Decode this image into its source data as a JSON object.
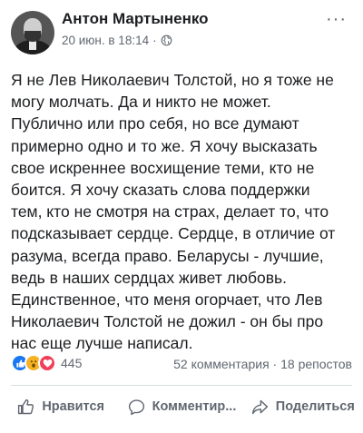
{
  "post": {
    "author": "Антон Мартыненко",
    "date": "20 июн. в 18:14",
    "separator": "·",
    "more_label": "···",
    "text_lines": [
      "Я не Лев Николаевич Толстой, но я тоже не",
      "могу молчать. Да и никто не может.",
      "Публично или про себя, но все думают",
      "примерно одно и то же.  Я хочу высказать",
      "свое искреннее восхищение теми, кто не",
      "боится. Я хочу сказать слова поддержки",
      "тем, кто не смотря на страх, делает то, что",
      "подсказывает сердце. Сердце, в отличие от",
      "разума, всегда право. Беларусы - лучшие,",
      "ведь в наших сердцах живет любовь.",
      "Единственное, что меня огорчает, что Лев",
      "Николаевич Толстой не дожил - он бы про",
      "нас еще  лучше написал."
    ]
  },
  "stats": {
    "reaction_count": "445",
    "comments": "52 комментария",
    "dot": "·",
    "shares": "18 репостов"
  },
  "actions": {
    "like": "Нравится",
    "comment": "Комментир...",
    "share": "Поделиться"
  },
  "icons": {
    "privacy": "globe-icon",
    "like": "thumbs-up-icon",
    "comment": "comment-bubble-icon",
    "share": "share-arrow-icon"
  },
  "colors": {
    "like_reaction": "#1877f2",
    "love_reaction": "#f33e58",
    "wow_reaction": "#f7b125",
    "secondary_text": "#606770"
  }
}
